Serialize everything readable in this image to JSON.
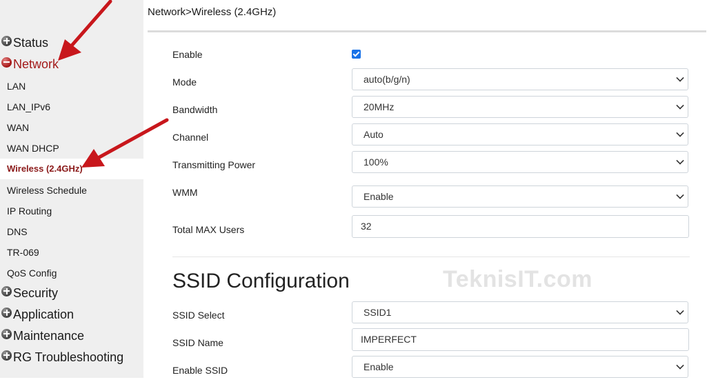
{
  "breadcrumb": "Network>Wireless (2.4GHz)",
  "sidebar": {
    "groups": [
      {
        "label": "Status",
        "expanded": false
      },
      {
        "label": "Network",
        "expanded": true
      },
      {
        "label": "Security",
        "expanded": false
      },
      {
        "label": "Application",
        "expanded": false
      },
      {
        "label": "Maintenance",
        "expanded": false
      },
      {
        "label": "RG Troubleshooting",
        "expanded": false
      }
    ],
    "network_items": [
      "LAN",
      "LAN_IPv6",
      "WAN",
      "WAN DHCP",
      "Wireless (2.4GHz)",
      "Wireless Schedule",
      "IP Routing",
      "DNS",
      "TR-069",
      "QoS Config"
    ],
    "selected_item": "Wireless (2.4GHz)"
  },
  "wireless": {
    "enable_label": "Enable",
    "enable_checked": true,
    "mode_label": "Mode",
    "mode_value": "auto(b/g/n)",
    "bandwidth_label": "Bandwidth",
    "bandwidth_value": "20MHz",
    "channel_label": "Channel",
    "channel_value": "Auto",
    "power_label": "Transmitting Power",
    "power_value": "100%",
    "wmm_label": "WMM",
    "wmm_value": "Enable",
    "max_users_label": "Total MAX Users",
    "max_users_value": "32"
  },
  "ssid": {
    "heading": "SSID Configuration",
    "select_label": "SSID Select",
    "select_value": "SSID1",
    "name_label": "SSID Name",
    "name_value": "IMPERFECT",
    "enable_label": "Enable SSID",
    "enable_value": "Enable"
  },
  "watermark": "TeknisIT.com",
  "colors": {
    "accent_red": "#a31a1a",
    "arrow_red": "#c8171c",
    "sidebar_bg": "#efefef",
    "checkbox_blue": "#1a73e8"
  }
}
